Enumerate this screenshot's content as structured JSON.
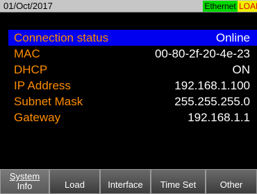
{
  "statusbar": {
    "date": "01/Oct/2017",
    "ethernet_badge": "Ethernet",
    "load_badge": "LOAD"
  },
  "info": {
    "rows": [
      {
        "label": "Connection status",
        "value": "Online"
      },
      {
        "label": "MAC",
        "value": "00-80-2f-20-4e-23"
      },
      {
        "label": "DHCP",
        "value": "ON"
      },
      {
        "label": "IP Address",
        "value": "192.168.1.100"
      },
      {
        "label": "Subnet Mask",
        "value": "255.255.255.0"
      },
      {
        "label": "Gateway",
        "value": "192.168.1.1"
      }
    ]
  },
  "tabs": {
    "system_info_line1": "System",
    "system_info_line2": "Info",
    "load": "Load",
    "interface": "Interface",
    "time_set": "Time Set",
    "other": "Other"
  },
  "colors": {
    "label": "#ff8c00",
    "value": "#ffffff",
    "selected_row": "#0000f0",
    "ethernet_badge": "#00d800",
    "load_badge": "#f0f000"
  }
}
